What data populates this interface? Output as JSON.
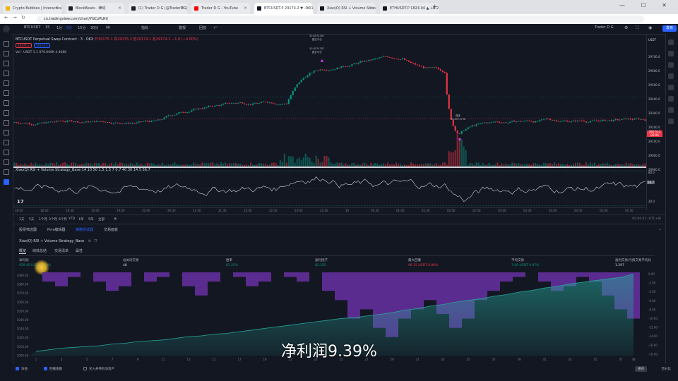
{
  "browser": {
    "tabs": [
      {
        "label": "Crypto Bubbles | Interactive",
        "color": "#f4b400",
        "active": false
      },
      {
        "label": "BlockBeats · 律动",
        "color": "#202124",
        "active": false
      },
      {
        "label": "(1) Trader D G (@TraderDG)",
        "color": "#202124",
        "active": false
      },
      {
        "label": "Trader D G - YouTube",
        "color": "#ff0000",
        "active": false
      },
      {
        "label": "BTCUSDT.P 29174.2 ▼ -0.01%",
        "color": "#131722",
        "active": true
      },
      {
        "label": "Xiao(Q) RSI + Volume Strategy",
        "color": "#131722",
        "active": false
      },
      {
        "label": "ETHUSDT.P 1824.04 ▲ +0.26%",
        "color": "#131722",
        "active": false
      }
    ],
    "new_tab": "+",
    "url": "cn.tradingview.com/chart/YGCzPLRt/",
    "window_buttons": "— ☐ ✕"
  },
  "toolbar": {
    "symbol": "BTCUSDT",
    "interval": "15",
    "intervals": [
      "1分",
      "5分",
      "15分",
      "30分"
    ],
    "indicators_label": "指标",
    "alert_label": "警报",
    "replay_label": "回放",
    "layout_name": "Trader D G",
    "publish_label": "发布"
  },
  "legend": {
    "symbol": "BTCUSDT Perpetual Swap Contract · 3 · OKX",
    "ohlc": "开29175.1 高29175.2 低29174.1 收29174.2 −1.0 (−0.00%)",
    "price_pill_1": "29174.1",
    "price_pill_2": "29174.2",
    "vol_line": "Vol · USDT  5.1  876.008K  4.468K"
  },
  "chart": {
    "price_axis_currency": "USDT",
    "price_levels": [
      "29700.0",
      "29600.0",
      "29500.0",
      "29400.0",
      "29300.0",
      "29200.0",
      "29100.0",
      "29000.0",
      "28900.0"
    ],
    "price_tag_value": "29174.2",
    "price_tag_time": "05:06",
    "annotations_top": [
      "30.6574787",
      "做空平仓",
      "30.6574787",
      "做空平仓"
    ],
    "annotation_low": [
      "做多",
      "30.6574798"
    ]
  },
  "indicator": {
    "title": "Xiao(Q) RSI + Volume Strategy_Base  14 10 50 1.5 1.5 7 0.7 40 30 14 5  56.7",
    "rsi_levels": [
      "80.0",
      "56.7",
      "20.0"
    ],
    "time_labels": [
      "16:00",
      "18:00",
      "18:30",
      "19:00",
      "19:30",
      "20:00",
      "20:30",
      "21:00",
      "21:30",
      "22:00",
      "22:30",
      "23:00",
      "23:30",
      "16",
      "00:30",
      "01:00",
      "01:30",
      "02:00",
      "02:30",
      "03:00",
      "03:30",
      "04:00",
      "04:30",
      "05:00",
      "05:30"
    ]
  },
  "range_bar": {
    "ranges": [
      "1天",
      "5天",
      "1个月",
      "3个月",
      "6个月",
      "YTD",
      "1年",
      "5年",
      "全部"
    ],
    "clock": "05:06:41 (UTC+8)"
  },
  "bottom_tabs": [
    "股票筛选器",
    "Pine编辑器",
    "策略测试器",
    "交易面板"
  ],
  "strategy": {
    "name": "Xiao(Q) RSI + Volume Strategy_Base",
    "subtabs": [
      "概览",
      "绩效总结",
      "交易清单",
      "属性"
    ],
    "metrics": [
      {
        "label": "净利润",
        "value": "939.45 USDT  9.39%",
        "tone": "green"
      },
      {
        "label": "总关闭交易",
        "value": "48",
        "tone": "white"
      },
      {
        "label": "胜率",
        "value": "81.25%",
        "tone": "green"
      },
      {
        "label": "盈利因子",
        "value": "82.325",
        "tone": "green"
      },
      {
        "label": "最大回撤",
        "value": "96.15 USDT  0.86%",
        "tone": "red"
      },
      {
        "label": "平均交易",
        "value": "7.08 USDT  0.07%",
        "tone": "green"
      },
      {
        "label": "盈利交易/亏损交易平均比",
        "value": "1.297",
        "tone": "white"
      }
    ],
    "equity_axis": [
      "1090.00",
      "1080.00",
      "1070.00",
      "1060.00",
      "1050.00",
      "1040.00",
      "1030.00",
      "1020.00",
      "1010.00",
      "1000.00"
    ],
    "drawdown_axis": [
      "0.00",
      "-2.00",
      "-4.00",
      "-6.00",
      "-8.00",
      "-10.00",
      "-12.00",
      "-14.00",
      "-16.00",
      "-18.00"
    ],
    "trade_labels": [
      "1",
      "3",
      "5",
      "7",
      "9",
      "11",
      "13",
      "15",
      "17",
      "19",
      "21",
      "23",
      "25",
      "27",
      "29",
      "31",
      "33",
      "35",
      "37",
      "39",
      "41",
      "43",
      "45",
      "47",
      "48"
    ],
    "legend": [
      {
        "label": "净值",
        "checked": true
      },
      {
        "label": "回撤金额",
        "checked": true
      },
      {
        "label": "买入并持有净资产",
        "checked": false
      }
    ],
    "abs_button": "绝对",
    "pct_button": "百分比"
  },
  "chart_data": {
    "type": "area",
    "title": "",
    "x": [
      1,
      2,
      3,
      4,
      5,
      6,
      7,
      8,
      9,
      10,
      11,
      12,
      13,
      14,
      15,
      16,
      17,
      18,
      19,
      20,
      21,
      22,
      23,
      24,
      25,
      26,
      27,
      28,
      29,
      30,
      31,
      32,
      33,
      34,
      35,
      36,
      37,
      38,
      39,
      40,
      41,
      42,
      43,
      44,
      45,
      46,
      47,
      48
    ],
    "series": [
      {
        "values": [
          1000,
          1002,
          1004,
          1005,
          1006,
          1007,
          1009,
          1010,
          1012,
          1013,
          1014,
          1016,
          1018,
          1019,
          1021,
          1022,
          1024,
          1026,
          1028,
          1030,
          1032,
          1034,
          1036,
          1038,
          1040,
          1041,
          1043,
          1045,
          1047,
          1050,
          1052,
          1055,
          1057,
          1060,
          1062,
          1064,
          1067,
          1069,
          1072,
          1074,
          1077,
          1079,
          1082,
          1084,
          1086,
          1088,
          1090,
          1094
        ]
      },
      {
        "values": [
          0,
          -2,
          -3,
          -1,
          0,
          -2,
          -4,
          -3,
          0,
          -2,
          -1,
          0,
          -3,
          -5,
          -2,
          0,
          -1,
          -3,
          -2,
          0,
          -1,
          -2,
          0,
          -4,
          -6,
          -10,
          -8,
          -12,
          -14,
          -10,
          -8,
          -6,
          -9,
          -12,
          -10,
          -6,
          -4,
          -2,
          -1,
          0,
          -2,
          -4,
          -3,
          -1,
          -2,
          -5,
          -8,
          -10
        ]
      }
    ],
    "ylim": [
      995,
      1096
    ],
    "y2lim": [
      -18,
      0
    ]
  }
}
